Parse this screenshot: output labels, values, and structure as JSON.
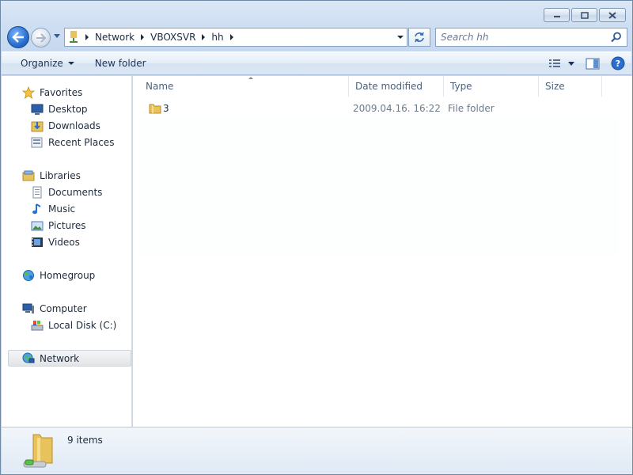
{
  "address": {
    "crumbs": [
      "Network",
      "VBOXSVR",
      "hh"
    ]
  },
  "search": {
    "placeholder": "Search hh"
  },
  "toolbar": {
    "organize_label": "Organize",
    "new_folder_label": "New folder"
  },
  "navpane": {
    "favorites": {
      "label": "Favorites",
      "icon": "star-icon",
      "items": [
        {
          "label": "Desktop",
          "icon": "desktop-icon"
        },
        {
          "label": "Downloads",
          "icon": "downloads-icon"
        },
        {
          "label": "Recent Places",
          "icon": "recent-places-icon"
        }
      ]
    },
    "libraries": {
      "label": "Libraries",
      "icon": "libraries-icon",
      "items": [
        {
          "label": "Documents",
          "icon": "documents-icon"
        },
        {
          "label": "Music",
          "icon": "music-icon"
        },
        {
          "label": "Pictures",
          "icon": "pictures-icon"
        },
        {
          "label": "Videos",
          "icon": "videos-icon"
        }
      ]
    },
    "homegroup": {
      "label": "Homegroup",
      "icon": "homegroup-icon"
    },
    "computer": {
      "label": "Computer",
      "icon": "computer-icon",
      "items": [
        {
          "label": "Local Disk (C:)",
          "icon": "local-disk-icon"
        }
      ]
    },
    "network": {
      "label": "Network",
      "icon": "network-icon",
      "selected": true
    }
  },
  "columns": {
    "name": "Name",
    "date_modified": "Date modified",
    "type": "Type",
    "size": "Size"
  },
  "files": [
    {
      "name": "3",
      "date_modified": "2009.04.16. 16:22",
      "type": "File folder",
      "size": ""
    }
  ],
  "details": {
    "count_text": "9 items"
  },
  "colors": {
    "accent": "#2a6fd0",
    "folder": "#e8c25a",
    "selection": "#e2e4e6"
  }
}
